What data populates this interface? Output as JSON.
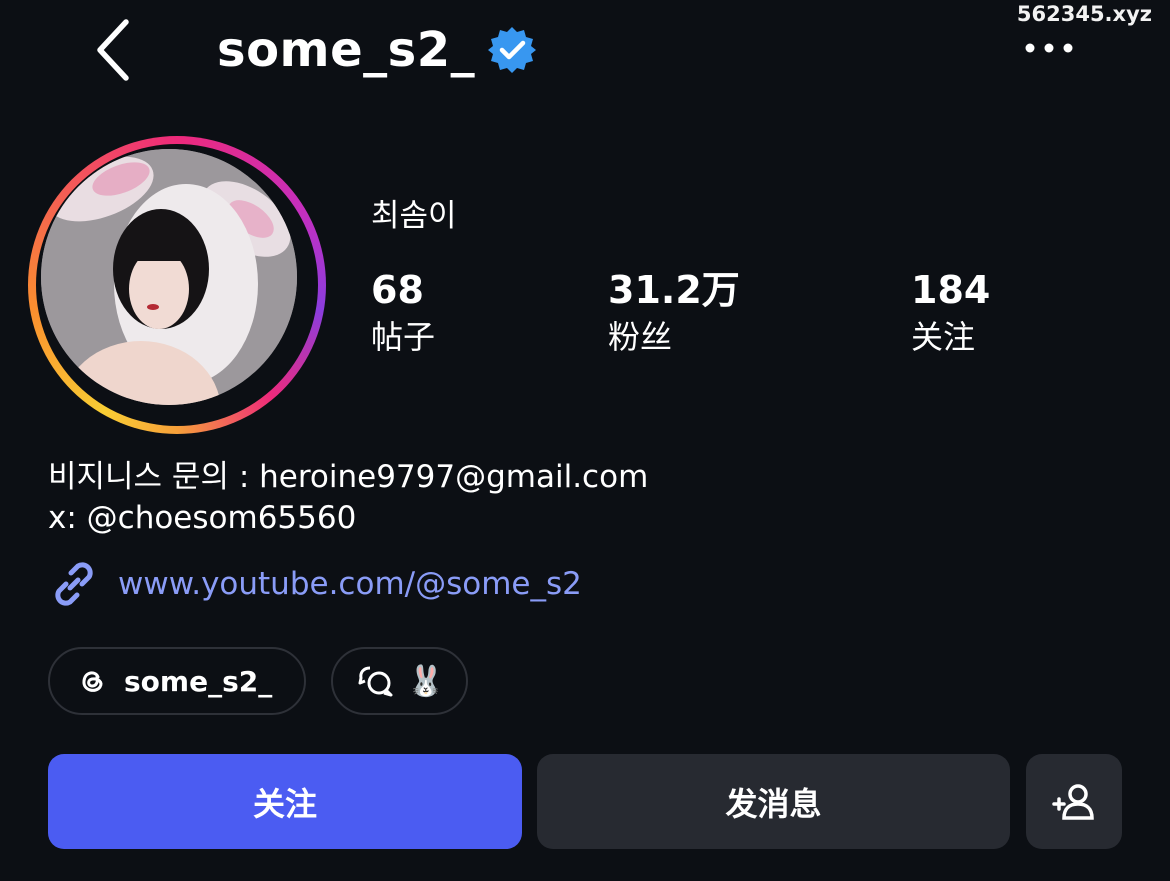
{
  "watermark": "562345.xyz",
  "header": {
    "username": "some_s2_",
    "back_icon": "chevron-left-icon",
    "verified_icon": "verified-badge-icon",
    "more_icon": "more-horizontal-icon"
  },
  "profile": {
    "display_name": "최솜이",
    "stats": [
      {
        "value": "68",
        "label": "帖子"
      },
      {
        "value": "31.2万",
        "label": "粉丝"
      },
      {
        "value": "184",
        "label": "关注"
      }
    ]
  },
  "bio": {
    "line1": "비지니스 문의 : heroine9797@gmail.com",
    "line2": "x: @choesom65560",
    "link_icon": "link-icon",
    "link": "www.youtube.com/@some_s2"
  },
  "chips": [
    {
      "icon": "threads-icon",
      "label": "some_s2_"
    },
    {
      "icon": "chat-bubbles-icon",
      "label": "🐰"
    }
  ],
  "actions": {
    "follow": "关注",
    "message": "发消息",
    "add_user_icon": "add-person-icon"
  },
  "colors": {
    "background": "#0c0f14",
    "accent": "#4b5cf2",
    "link": "#8a9cf7",
    "verified": "#3897f0",
    "secondary_button": "#272a31"
  }
}
